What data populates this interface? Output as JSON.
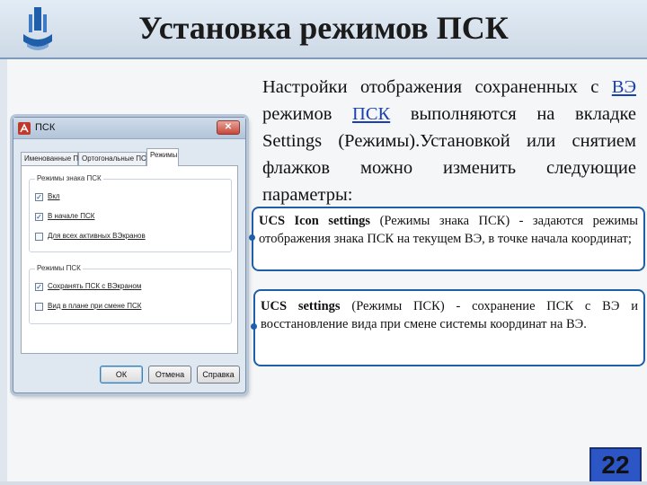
{
  "slide": {
    "title": "Установка режимов ПСК",
    "page_number": "22"
  },
  "dialog": {
    "title": "ПСК",
    "close_label": "✕",
    "tabs": [
      {
        "label": "Именованные ПСК"
      },
      {
        "label": "Ортогональные ПСК"
      },
      {
        "label": "Режимы"
      }
    ],
    "groups": [
      {
        "title": "Режимы знака ПСК",
        "checkboxes": [
          {
            "label": "Вкл",
            "checked": true,
            "mark": "✓"
          },
          {
            "label": "В начале ПСК",
            "checked": true,
            "mark": "✓"
          },
          {
            "label": "Для всех активных ВЭкранов",
            "checked": false,
            "mark": ""
          }
        ]
      },
      {
        "title": "Режимы ПСК",
        "checkboxes": [
          {
            "label": "Сохранять ПСК с ВЭкраном",
            "checked": true,
            "mark": "✓"
          },
          {
            "label": "Вид в плане при смене ПСК",
            "checked": false,
            "mark": ""
          }
        ]
      }
    ],
    "buttons": {
      "ok": "ОК",
      "cancel": "Отмена",
      "help": "Справка"
    }
  },
  "body": {
    "part1": "Настройки отображения сохраненных с",
    "link1": "ВЭ",
    "part2": "режимов",
    "link2": "ПСК",
    "part3": "выполняются на вкладке Settings (Режимы).Установкой или снятием флажков можно изменить следующие параметры:"
  },
  "callouts": [
    {
      "bold": "UCS Icon settings",
      "text": "(Режимы знака ПСК) - задаются режимы отображения знака ПСК на текущем ВЭ, в точке начала координат;"
    },
    {
      "bold": "UCS settings",
      "text": "(Режимы ПСК) - сохранение ПСК с ВЭ и восстановление вида при смене системы координат на ВЭ."
    }
  ],
  "colors": {
    "accent": "#1f5ea8",
    "link": "#1a3fb0",
    "page_badge": "#2c56c6"
  }
}
